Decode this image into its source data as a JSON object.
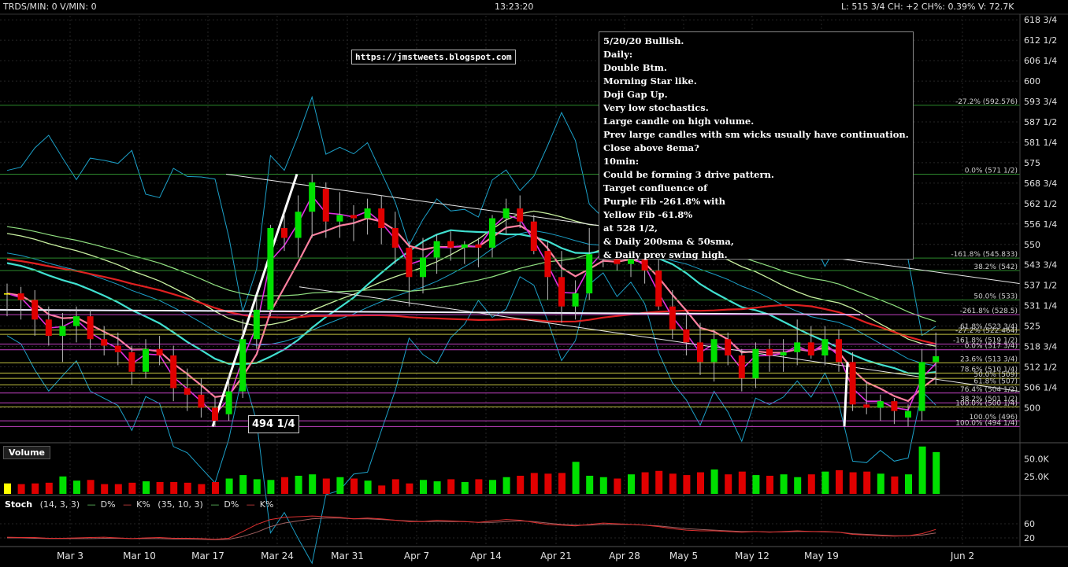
{
  "toolbar": {
    "left": "TRDS/MIN: 0 V/MIN: 0",
    "time": "13:23:20",
    "right": "L: 515 3/4 CH: +2 CH%: 0.39% V: 72.7K"
  },
  "url_box": "https://jmstweets.blogspot.com",
  "note_lines": [
    "5/20/20 Bullish.",
    "Daily:",
    "Double Btm.",
    "Morning Star like.",
    "Doji Gap Up.",
    "Very low stochastics.",
    "Large candle on high volume.",
    "Prev large candles with sm wicks usually have continuation.",
    "Close above 8ema?",
    "10min:",
    "Could be forming 3 drive pattern.",
    "Target confluence of",
    "Purple Fib -261.8% with",
    "Yellow Fib -61.8%",
    "at 528 1/2,",
    "& Daily 200sma & 50sma,",
    "& Daily prev swing high."
  ],
  "low_label": "494 1/4",
  "volume_title": "Volume",
  "stoch": {
    "title": "Stoch",
    "params1": "(14, 3, 3)",
    "d1": "D%",
    "k1": "K%",
    "params2": "(35, 10, 3)",
    "d2": "D%",
    "k2": "K%"
  },
  "colors": {
    "up": "#00e000",
    "down": "#e00000",
    "doji": "#ffff00",
    "ema_pink": "#ff80a0",
    "ema_magenta": "#e030e0",
    "sma_red": "#e02020",
    "sma_teal": "#40e0d0",
    "bollinger": "#1ca0c8"
  },
  "fib_labels": [
    {
      "text": "-27.2% (592.576)",
      "price": 592.576
    },
    {
      "text": "0.0% (571 1/2)",
      "price": 571.5
    },
    {
      "text": "-161.8% (545.833)",
      "price": 545.833
    },
    {
      "text": "38.2% (542)",
      "price": 542
    },
    {
      "text": "50.0% (533)",
      "price": 533
    },
    {
      "text": "-261.8% (528.5)",
      "price": 528.5
    },
    {
      "text": "61.8% (523 3/4)",
      "price": 523.75
    },
    {
      "text": "-27.2% (522.464)",
      "price": 522.46
    },
    {
      "text": "-161.8% (519 1/2)",
      "price": 519.5
    },
    {
      "text": "0.0% (517 3/4)",
      "price": 517.75
    },
    {
      "text": "23.6% (513 3/4)",
      "price": 513.75
    },
    {
      "text": "78.6% (510 1/4)",
      "price": 510.6
    },
    {
      "text": "50.0% (509)",
      "price": 509
    },
    {
      "text": "61.8% (507)",
      "price": 507
    },
    {
      "text": "76.4% (504 1/2)",
      "price": 504.5
    },
    {
      "text": "38.2% (501 1/2)",
      "price": 501.5
    },
    {
      "text": "100.0% (500 1/4)",
      "price": 500.25
    },
    {
      "text": "100.0% (496)",
      "price": 496
    },
    {
      "text": "100.0% (494 1/4)",
      "price": 494.25
    }
  ],
  "chart_data": {
    "type": "candlestick",
    "title": "",
    "y_axis_labels": [
      "618 3/4",
      "612 1/2",
      "606 1/4",
      "600",
      "593 3/4",
      "587 1/2",
      "581 1/4",
      "575",
      "568 3/4",
      "562 1/2",
      "556 1/4",
      "550",
      "543 3/4",
      "537 1/2",
      "531 1/4",
      "525",
      "518 3/4",
      "512 1/2",
      "506 1/4",
      "500"
    ],
    "y_axis_values": [
      618.75,
      612.5,
      606.25,
      600,
      593.75,
      587.5,
      581.25,
      575,
      568.75,
      562.5,
      556.25,
      550,
      543.75,
      537.5,
      531.25,
      525,
      518.75,
      512.5,
      506.25,
      500
    ],
    "x_labels": [
      "Mar 3",
      "Mar 10",
      "Mar 17",
      "Mar 24",
      "Mar 31",
      "Apr 7",
      "Apr 14",
      "Apr 21",
      "Apr 28",
      "May 5",
      "May 12",
      "May 19",
      "Jun 2"
    ],
    "ylim": [
      490,
      620
    ],
    "volume_axis_labels": [
      "50.0K",
      "25.0K"
    ],
    "volume_axis_values": [
      50000,
      25000
    ],
    "stoch_axis_labels": [
      "60",
      "20"
    ],
    "stoch_axis_values": [
      60,
      20
    ],
    "candles": [
      {
        "o": 535,
        "h": 538,
        "l": 528,
        "c": 535
      },
      {
        "o": 535,
        "h": 537,
        "l": 527,
        "c": 533
      },
      {
        "o": 533,
        "h": 536,
        "l": 522,
        "c": 527
      },
      {
        "o": 527,
        "h": 531,
        "l": 519,
        "c": 522
      },
      {
        "o": 522,
        "h": 529,
        "l": 514,
        "c": 525
      },
      {
        "o": 525,
        "h": 531,
        "l": 520,
        "c": 528
      },
      {
        "o": 528,
        "h": 530,
        "l": 518,
        "c": 521
      },
      {
        "o": 521,
        "h": 525,
        "l": 516,
        "c": 519
      },
      {
        "o": 519,
        "h": 523,
        "l": 513,
        "c": 517
      },
      {
        "o": 517,
        "h": 519,
        "l": 507,
        "c": 511
      },
      {
        "o": 511,
        "h": 521,
        "l": 509,
        "c": 518
      },
      {
        "o": 518,
        "h": 522,
        "l": 513,
        "c": 516
      },
      {
        "o": 516,
        "h": 519,
        "l": 502,
        "c": 506
      },
      {
        "o": 506,
        "h": 512,
        "l": 499,
        "c": 504
      },
      {
        "o": 504,
        "h": 509,
        "l": 497,
        "c": 500
      },
      {
        "o": 500,
        "h": 503,
        "l": 494.25,
        "c": 496
      },
      {
        "o": 498,
        "h": 510,
        "l": 496,
        "c": 505
      },
      {
        "o": 505,
        "h": 527,
        "l": 503,
        "c": 521
      },
      {
        "o": 521,
        "h": 534,
        "l": 518,
        "c": 530
      },
      {
        "o": 530,
        "h": 556,
        "l": 528,
        "c": 555
      },
      {
        "o": 555,
        "h": 560,
        "l": 548,
        "c": 552
      },
      {
        "o": 552,
        "h": 565,
        "l": 546,
        "c": 560
      },
      {
        "o": 560,
        "h": 571.5,
        "l": 552,
        "c": 569
      },
      {
        "o": 567,
        "h": 569,
        "l": 552,
        "c": 557
      },
      {
        "o": 557,
        "h": 566,
        "l": 552,
        "c": 559
      },
      {
        "o": 559,
        "h": 562,
        "l": 551,
        "c": 558
      },
      {
        "o": 558,
        "h": 564,
        "l": 553,
        "c": 561
      },
      {
        "o": 561,
        "h": 565,
        "l": 550,
        "c": 555
      },
      {
        "o": 555,
        "h": 560,
        "l": 544,
        "c": 549
      },
      {
        "o": 549,
        "h": 551,
        "l": 531,
        "c": 540
      },
      {
        "o": 540,
        "h": 552,
        "l": 535,
        "c": 546
      },
      {
        "o": 546,
        "h": 553,
        "l": 541,
        "c": 551
      },
      {
        "o": 551,
        "h": 554,
        "l": 545,
        "c": 549
      },
      {
        "o": 549,
        "h": 551,
        "l": 544,
        "c": 550
      },
      {
        "o": 550,
        "h": 552,
        "l": 543,
        "c": 549
      },
      {
        "o": 549,
        "h": 559,
        "l": 546,
        "c": 558
      },
      {
        "o": 558,
        "h": 564,
        "l": 553,
        "c": 561
      },
      {
        "o": 561,
        "h": 565,
        "l": 555,
        "c": 557
      },
      {
        "o": 557,
        "h": 559,
        "l": 547,
        "c": 548
      },
      {
        "o": 548,
        "h": 551,
        "l": 533,
        "c": 540
      },
      {
        "o": 540,
        "h": 548,
        "l": 526,
        "c": 531
      },
      {
        "o": 531,
        "h": 539,
        "l": 527,
        "c": 535
      },
      {
        "o": 535,
        "h": 555,
        "l": 533,
        "c": 547
      },
      {
        "o": 547,
        "h": 562,
        "l": 543,
        "c": 550
      },
      {
        "o": 550,
        "h": 555,
        "l": 542,
        "c": 544
      },
      {
        "o": 544,
        "h": 550,
        "l": 540,
        "c": 547
      },
      {
        "o": 547,
        "h": 549,
        "l": 538,
        "c": 542
      },
      {
        "o": 542,
        "h": 547,
        "l": 530,
        "c": 531
      },
      {
        "o": 531,
        "h": 536,
        "l": 521,
        "c": 524
      },
      {
        "o": 524,
        "h": 529,
        "l": 516,
        "c": 520
      },
      {
        "o": 520,
        "h": 526,
        "l": 510,
        "c": 514
      },
      {
        "o": 514,
        "h": 524,
        "l": 508,
        "c": 521
      },
      {
        "o": 521,
        "h": 523,
        "l": 513,
        "c": 516
      },
      {
        "o": 516,
        "h": 518,
        "l": 505,
        "c": 509
      },
      {
        "o": 509,
        "h": 520,
        "l": 506,
        "c": 518
      },
      {
        "o": 518,
        "h": 521,
        "l": 511,
        "c": 516
      },
      {
        "o": 516,
        "h": 521,
        "l": 511,
        "c": 517
      },
      {
        "o": 517,
        "h": 527,
        "l": 513,
        "c": 520
      },
      {
        "o": 520,
        "h": 525,
        "l": 515,
        "c": 516
      },
      {
        "o": 516,
        "h": 525,
        "l": 513,
        "c": 521
      },
      {
        "o": 521,
        "h": 524,
        "l": 511,
        "c": 514
      },
      {
        "o": 514,
        "h": 517,
        "l": 499,
        "c": 501
      },
      {
        "o": 501,
        "h": 508,
        "l": 498,
        "c": 500
      },
      {
        "o": 500,
        "h": 504,
        "l": 496,
        "c": 502
      },
      {
        "o": 502,
        "h": 503,
        "l": 495,
        "c": 499
      },
      {
        "o": 497,
        "h": 501,
        "l": 494.25,
        "c": 499
      },
      {
        "o": 499,
        "h": 518,
        "l": 496,
        "c": 514
      },
      {
        "o": 514,
        "h": 523,
        "l": 507,
        "c": 515.75
      }
    ],
    "volume": [
      15,
      14,
      15,
      16,
      25,
      19,
      20,
      14,
      14,
      16,
      18,
      17,
      17,
      16,
      14,
      17,
      22,
      27,
      21,
      20,
      24,
      26,
      28,
      22,
      24,
      22,
      19,
      12,
      21,
      15,
      20,
      18,
      21,
      17,
      21,
      20,
      24,
      26,
      30,
      29,
      30,
      46,
      26,
      24,
      22,
      28,
      31,
      33,
      29,
      27,
      31,
      35,
      28,
      32,
      27,
      26,
      28,
      24,
      28,
      32,
      34,
      31,
      32,
      29,
      25,
      28,
      68,
      60
    ],
    "stoch_k": [
      22,
      21,
      21,
      19,
      19,
      20,
      21,
      22,
      20,
      18,
      20,
      21,
      19,
      19,
      18,
      16,
      19,
      38,
      58,
      72,
      78,
      80,
      82,
      80,
      78,
      74,
      76,
      74,
      70,
      66,
      66,
      70,
      68,
      66,
      64,
      68,
      72,
      70,
      64,
      58,
      56,
      54,
      58,
      62,
      60,
      58,
      56,
      52,
      46,
      42,
      40,
      40,
      38,
      36,
      38,
      36,
      38,
      40,
      38,
      38,
      36,
      30,
      28,
      26,
      25,
      26,
      32,
      44
    ],
    "stoch_d": [
      20,
      20,
      19,
      18,
      18,
      18,
      18,
      19,
      19,
      18,
      18,
      18,
      17,
      17,
      16,
      15,
      16,
      24,
      36,
      52,
      62,
      68,
      74,
      76,
      76,
      74,
      74,
      72,
      70,
      68,
      66,
      66,
      66,
      66,
      64,
      64,
      66,
      68,
      66,
      62,
      58,
      56,
      56,
      58,
      58,
      58,
      56,
      54,
      50,
      46,
      44,
      42,
      40,
      38,
      38,
      37,
      37,
      38,
      38,
      37,
      36,
      32,
      30,
      28,
      26,
      26,
      28,
      34
    ]
  }
}
